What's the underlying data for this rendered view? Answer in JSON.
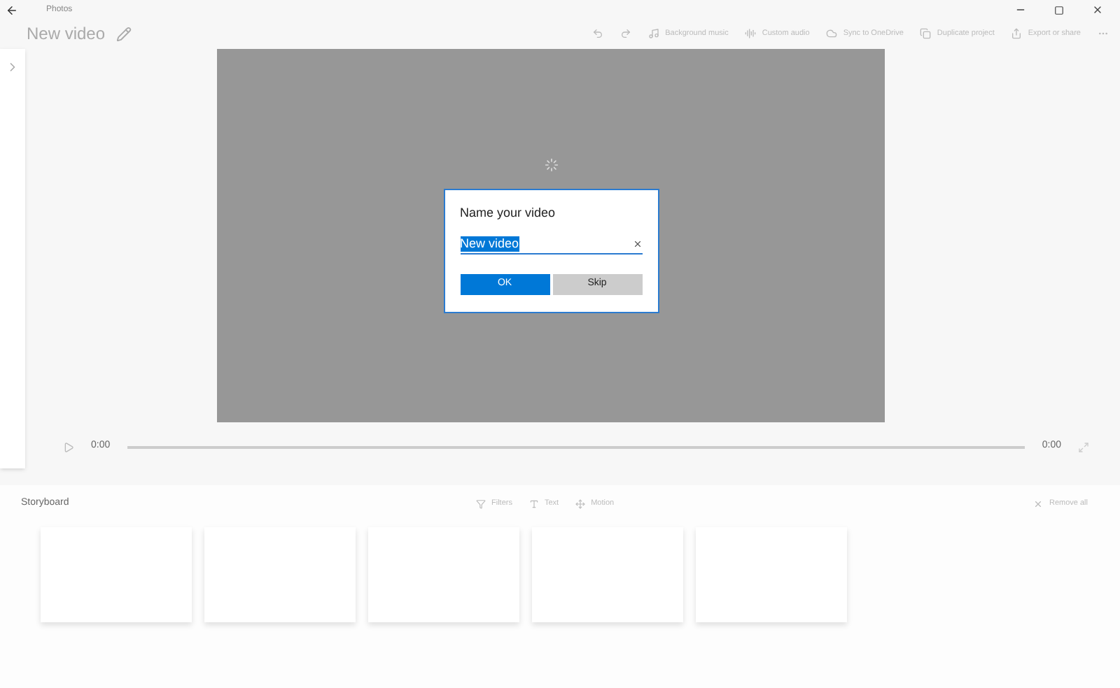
{
  "window": {
    "title": "Photos"
  },
  "project": {
    "title": "New video"
  },
  "toolbar": [
    {
      "kind": "undo"
    },
    {
      "kind": "redo"
    },
    {
      "kind": "music",
      "label": "Background music"
    },
    {
      "kind": "audio",
      "label": "Custom audio"
    },
    {
      "kind": "cloud",
      "label": "Sync to OneDrive"
    },
    {
      "kind": "copy",
      "label": "Duplicate project"
    },
    {
      "kind": "share",
      "label": "Export or share"
    },
    {
      "kind": "more"
    }
  ],
  "player": {
    "current_time": "0:00",
    "total_time": "0:00"
  },
  "dialog": {
    "title": "Name your video",
    "input": {
      "value": "New video",
      "selected": true
    },
    "buttons": [
      {
        "label": "OK",
        "primary": true
      },
      {
        "label": "Skip",
        "primary": false
      }
    ]
  },
  "storyboard": {
    "title": "Storyboard",
    "actions": [
      {
        "kind": "filters",
        "label": "Filters"
      },
      {
        "kind": "text",
        "label": "Text"
      },
      {
        "kind": "motion",
        "label": "Motion"
      }
    ],
    "remove_all": "Remove all",
    "cards": [
      {
        "kind": "empty"
      },
      {
        "kind": "empty"
      },
      {
        "kind": "empty"
      },
      {
        "kind": "empty"
      },
      {
        "kind": "empty"
      }
    ]
  }
}
